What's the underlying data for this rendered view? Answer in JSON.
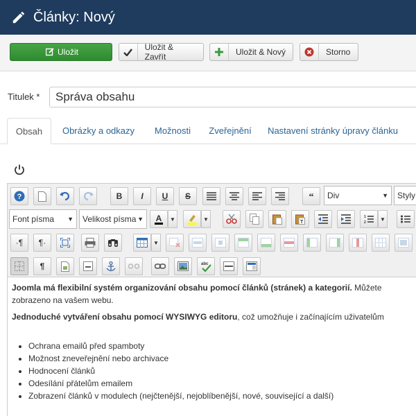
{
  "header": {
    "title": "Články: Nový"
  },
  "toolbar": {
    "save": "Uložit",
    "save_close": "Uložit & Zavřít",
    "save_new": "Uložit & Nový",
    "cancel": "Storno"
  },
  "title_field": {
    "label": "Titulek *",
    "value": "Správa obsahu"
  },
  "tabs": [
    {
      "label": "Obsah"
    },
    {
      "label": "Obrázky a odkazy"
    },
    {
      "label": "Možnosti"
    },
    {
      "label": "Zveřejnění"
    },
    {
      "label": "Nastavení stránky úpravy článku"
    }
  ],
  "editor": {
    "toolbar": {
      "bold": "B",
      "italic": "I",
      "underline": "U",
      "strike": "S",
      "format_select": "Div",
      "style_select": "Styly",
      "font_family": "Font písma",
      "font_size": "Velikost písma",
      "text_color": "A",
      "rtl": "·¶",
      "ltr": "¶·",
      "paragraph": "¶"
    },
    "content": {
      "p1_bold": "Joomla má flexibilní systém organizování obsahu pomocí článků (stránek) a kategorií.",
      "p1_rest": " Můžete",
      "p1_line2": "zobrazeno na vašem webu.",
      "p2_bold": "Jednoduché vytváření obsahu pomocí WYSIWYG editoru",
      "p2_rest": ", což umožňuje i začínajícím uživatelům",
      "list": [
        "Ochrana emailů před spamboty",
        "Možnost zneveřejnění nebo archivace",
        "Hodnocení článků",
        "Odesílání přátelům emailem",
        "Zobrazení článků v modulech (nejčtenější, nejoblíbenější, nové, související a další)"
      ]
    }
  },
  "colors": {
    "header_bg": "#1f3b5e",
    "save_green": "#3a9a3a",
    "link": "#2a6496"
  }
}
